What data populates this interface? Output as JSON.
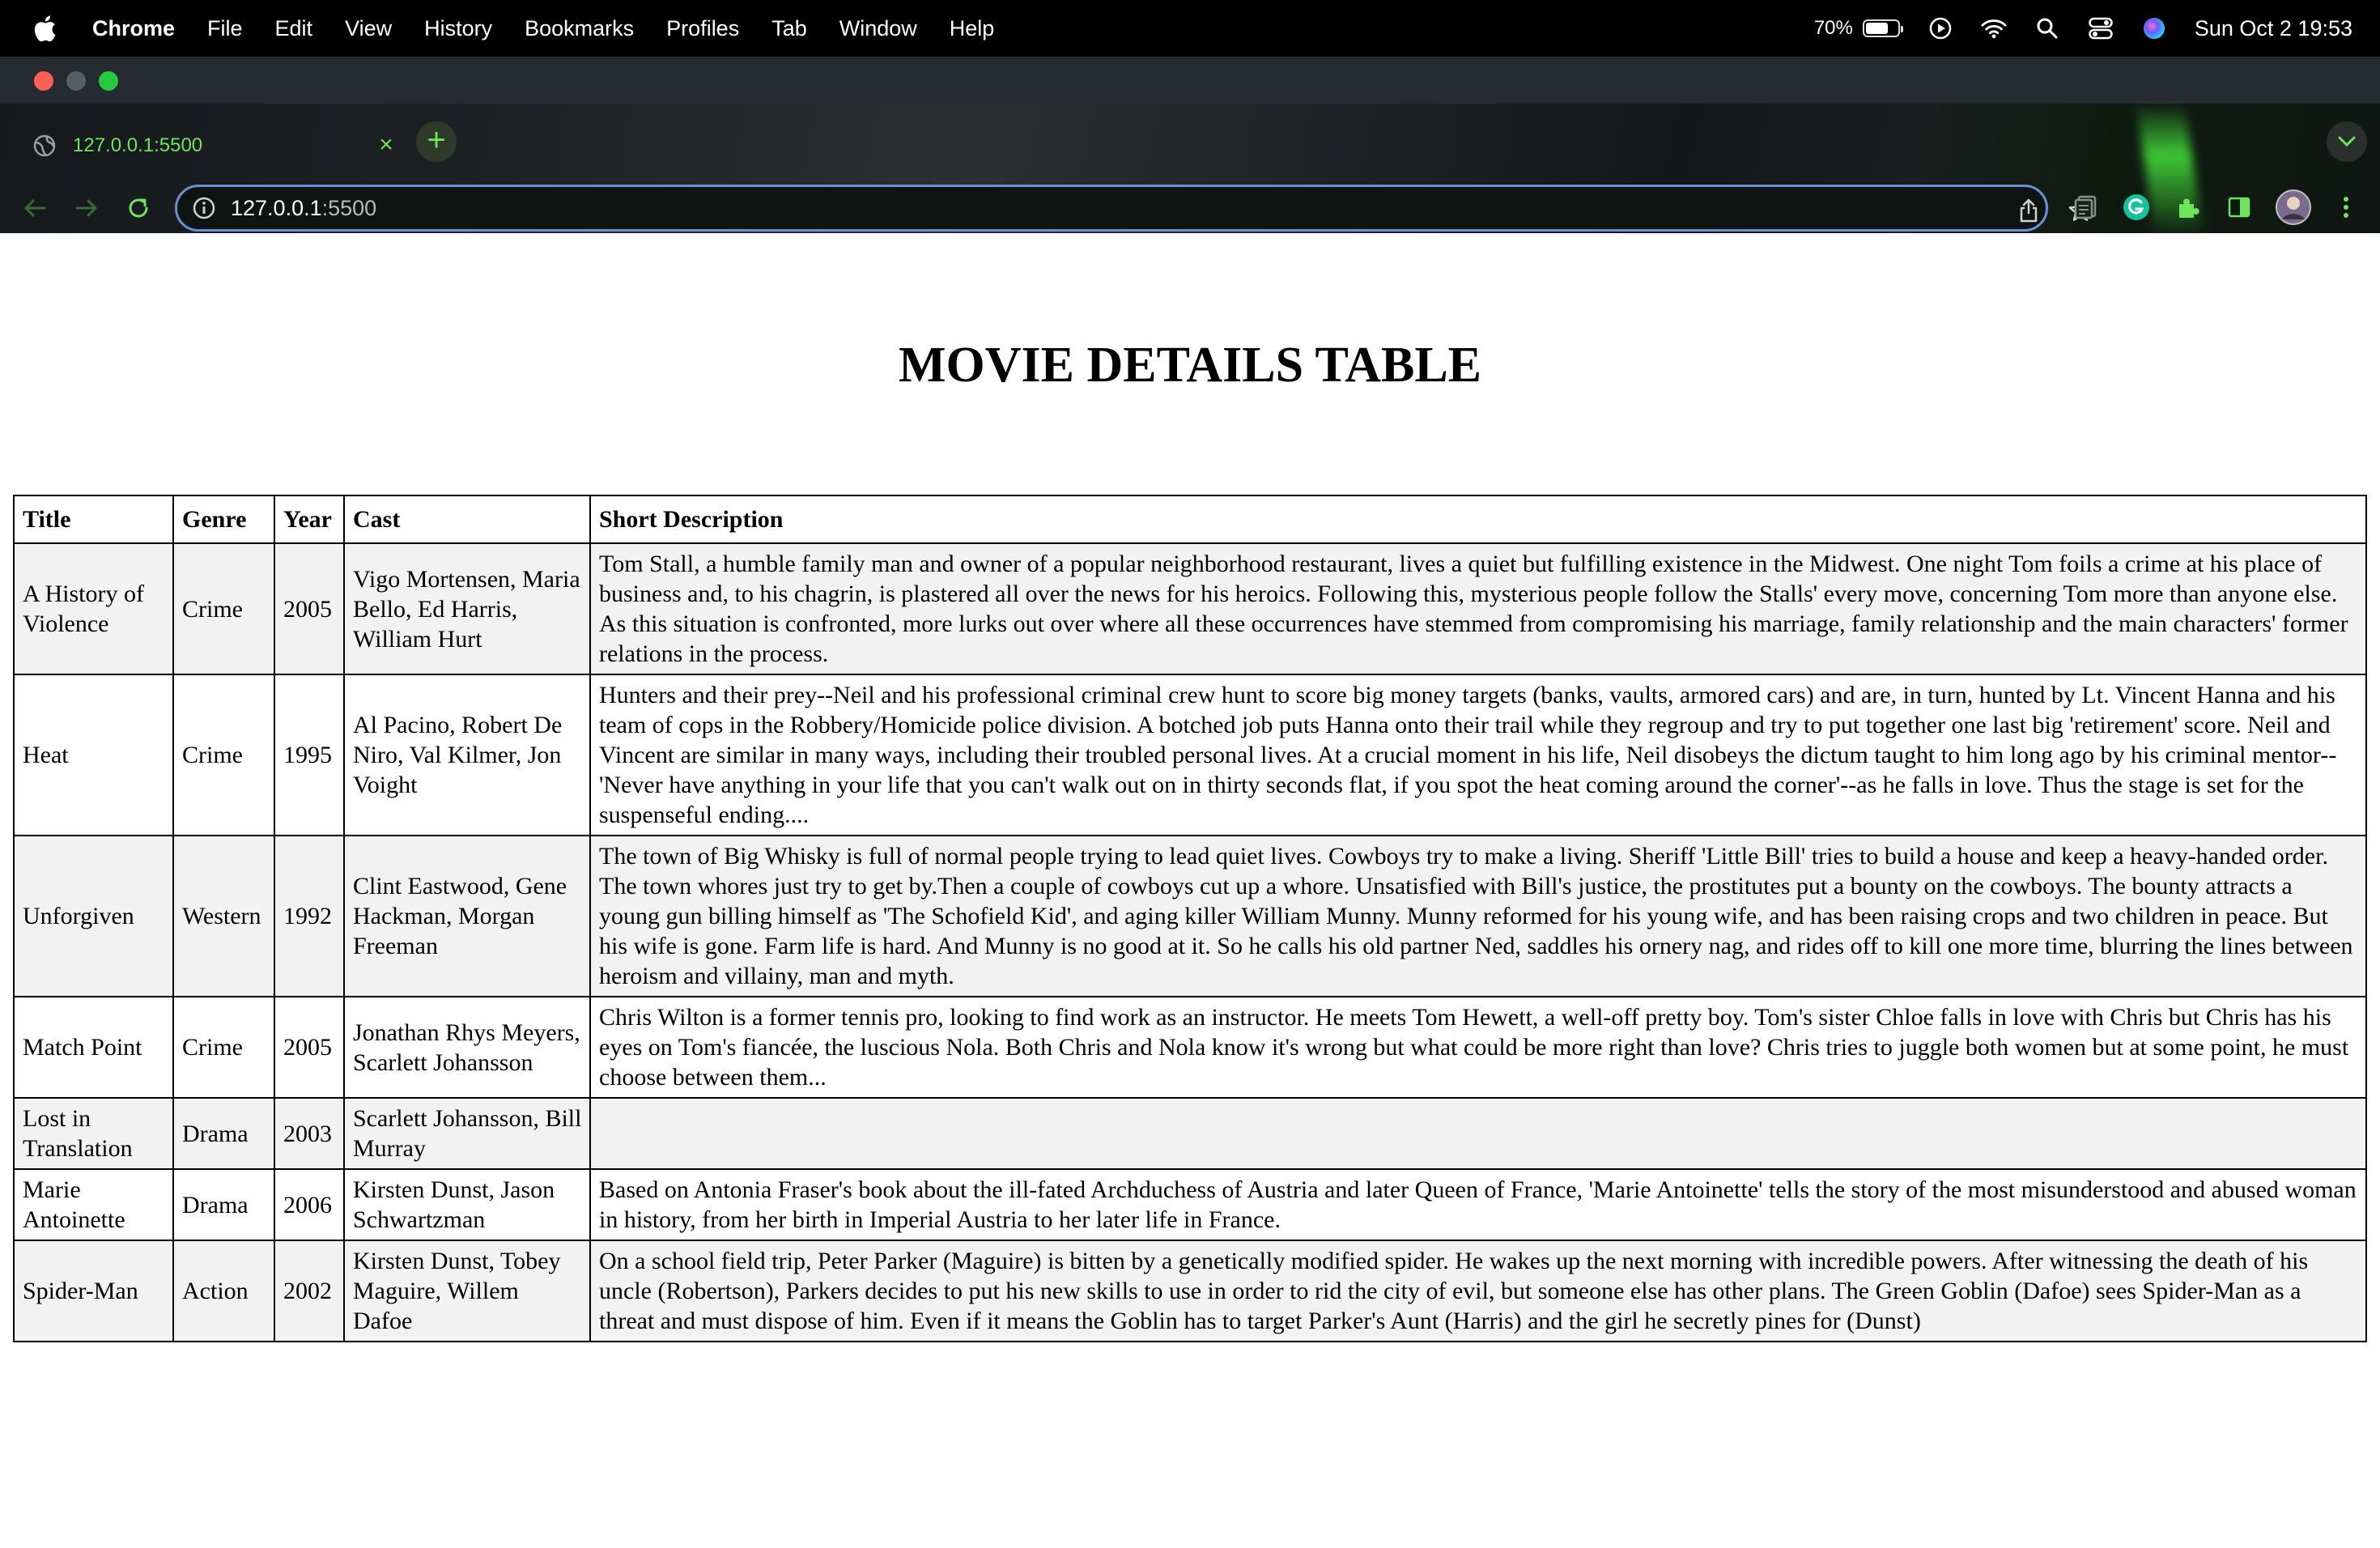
{
  "menubar": {
    "app_name": "Chrome",
    "items": [
      "File",
      "Edit",
      "View",
      "History",
      "Bookmarks",
      "Profiles",
      "Tab",
      "Window",
      "Help"
    ],
    "battery_percent": "70%",
    "battery_level": 0.7,
    "clock": "Sun Oct 2  19:53"
  },
  "browser": {
    "tab_title": "127.0.0.1:5500",
    "url_host": "127.0.0.1",
    "url_port": ":5500",
    "accent_color": "#6ee35c"
  },
  "page": {
    "heading": "MOVIE DETAILS TABLE",
    "columns": [
      "Title",
      "Genre",
      "Year",
      "Cast",
      "Short Description"
    ],
    "rows": [
      {
        "title": "A History of Violence",
        "genre": "Crime",
        "year": "2005",
        "cast": "Vigo Mortensen, Maria Bello, Ed Harris, William Hurt",
        "description": "Tom Stall, a humble family man and owner of a popular neighborhood restaurant, lives a quiet but fulfilling existence in the Midwest. One night Tom foils a crime at his place of business and, to his chagrin, is plastered all over the news for his heroics. Following this, mysterious people follow the Stalls' every move, concerning Tom more than anyone else. As this situation is confronted, more lurks out over where all these occurrences have stemmed from compromising his marriage, family relationship and the main characters' former relations in the process."
      },
      {
        "title": "Heat",
        "genre": "Crime",
        "year": "1995",
        "cast": "Al Pacino, Robert De Niro, Val Kilmer, Jon Voight",
        "description": "Hunters and their prey--Neil and his professional criminal crew hunt to score big money targets (banks, vaults, armored cars) and are, in turn, hunted by Lt. Vincent Hanna and his team of cops in the Robbery/Homicide police division. A botched job puts Hanna onto their trail while they regroup and try to put together one last big 'retirement' score. Neil and Vincent are similar in many ways, including their troubled personal lives. At a crucial moment in his life, Neil disobeys the dictum taught to him long ago by his criminal mentor--'Never have anything in your life that you can't walk out on in thirty seconds flat, if you spot the heat coming around the corner'--as he falls in love. Thus the stage is set for the suspenseful ending...."
      },
      {
        "title": "Unforgiven",
        "genre": "Western",
        "year": "1992",
        "cast": "Clint Eastwood, Gene Hackman, Morgan Freeman",
        "description": "The town of Big Whisky is full of normal people trying to lead quiet lives. Cowboys try to make a living. Sheriff 'Little Bill' tries to build a house and keep a heavy-handed order. The town whores just try to get by.Then a couple of cowboys cut up a whore. Unsatisfied with Bill's justice, the prostitutes put a bounty on the cowboys. The bounty attracts a young gun billing himself as 'The Schofield Kid', and aging killer William Munny. Munny reformed for his young wife, and has been raising crops and two children in peace. But his wife is gone. Farm life is hard. And Munny is no good at it. So he calls his old partner Ned, saddles his ornery nag, and rides off to kill one more time, blurring the lines between heroism and villainy, man and myth."
      },
      {
        "title": "Match Point",
        "genre": "Crime",
        "year": "2005",
        "cast": "Jonathan Rhys Meyers, Scarlett Johansson",
        "description": "Chris Wilton is a former tennis pro, looking to find work as an instructor. He meets Tom Hewett, a well-off pretty boy. Tom's sister Chloe falls in love with Chris but Chris has his eyes on Tom's fiancée, the luscious Nola. Both Chris and Nola know it's wrong but what could be more right than love? Chris tries to juggle both women but at some point, he must choose between them..."
      },
      {
        "title": "Lost in Translation",
        "genre": "Drama",
        "year": "2003",
        "cast": "Scarlett Johansson, Bill Murray",
        "description": ""
      },
      {
        "title": "Marie Antoinette",
        "genre": "Drama",
        "year": "2006",
        "cast": "Kirsten Dunst, Jason Schwartzman",
        "description": "Based on Antonia Fraser's book about the ill-fated Archduchess of Austria and later Queen of France, 'Marie Antoinette' tells the story of the most misunderstood and abused woman in history, from her birth in Imperial Austria to her later life in France."
      },
      {
        "title": "Spider-Man",
        "genre": "Action",
        "year": "2002",
        "cast": "Kirsten Dunst, Tobey Maguire, Willem Dafoe",
        "description": "On a school field trip, Peter Parker (Maguire) is bitten by a genetically modified spider. He wakes up the next morning with incredible powers. After witnessing the death of his uncle (Robertson), Parkers decides to put his new skills to use in order to rid the city of evil, but someone else has other plans. The Green Goblin (Dafoe) sees Spider-Man as a threat and must dispose of him. Even if it means the Goblin has to target Parker's Aunt (Harris) and the girl he secretly pines for (Dunst)"
      }
    ]
  }
}
